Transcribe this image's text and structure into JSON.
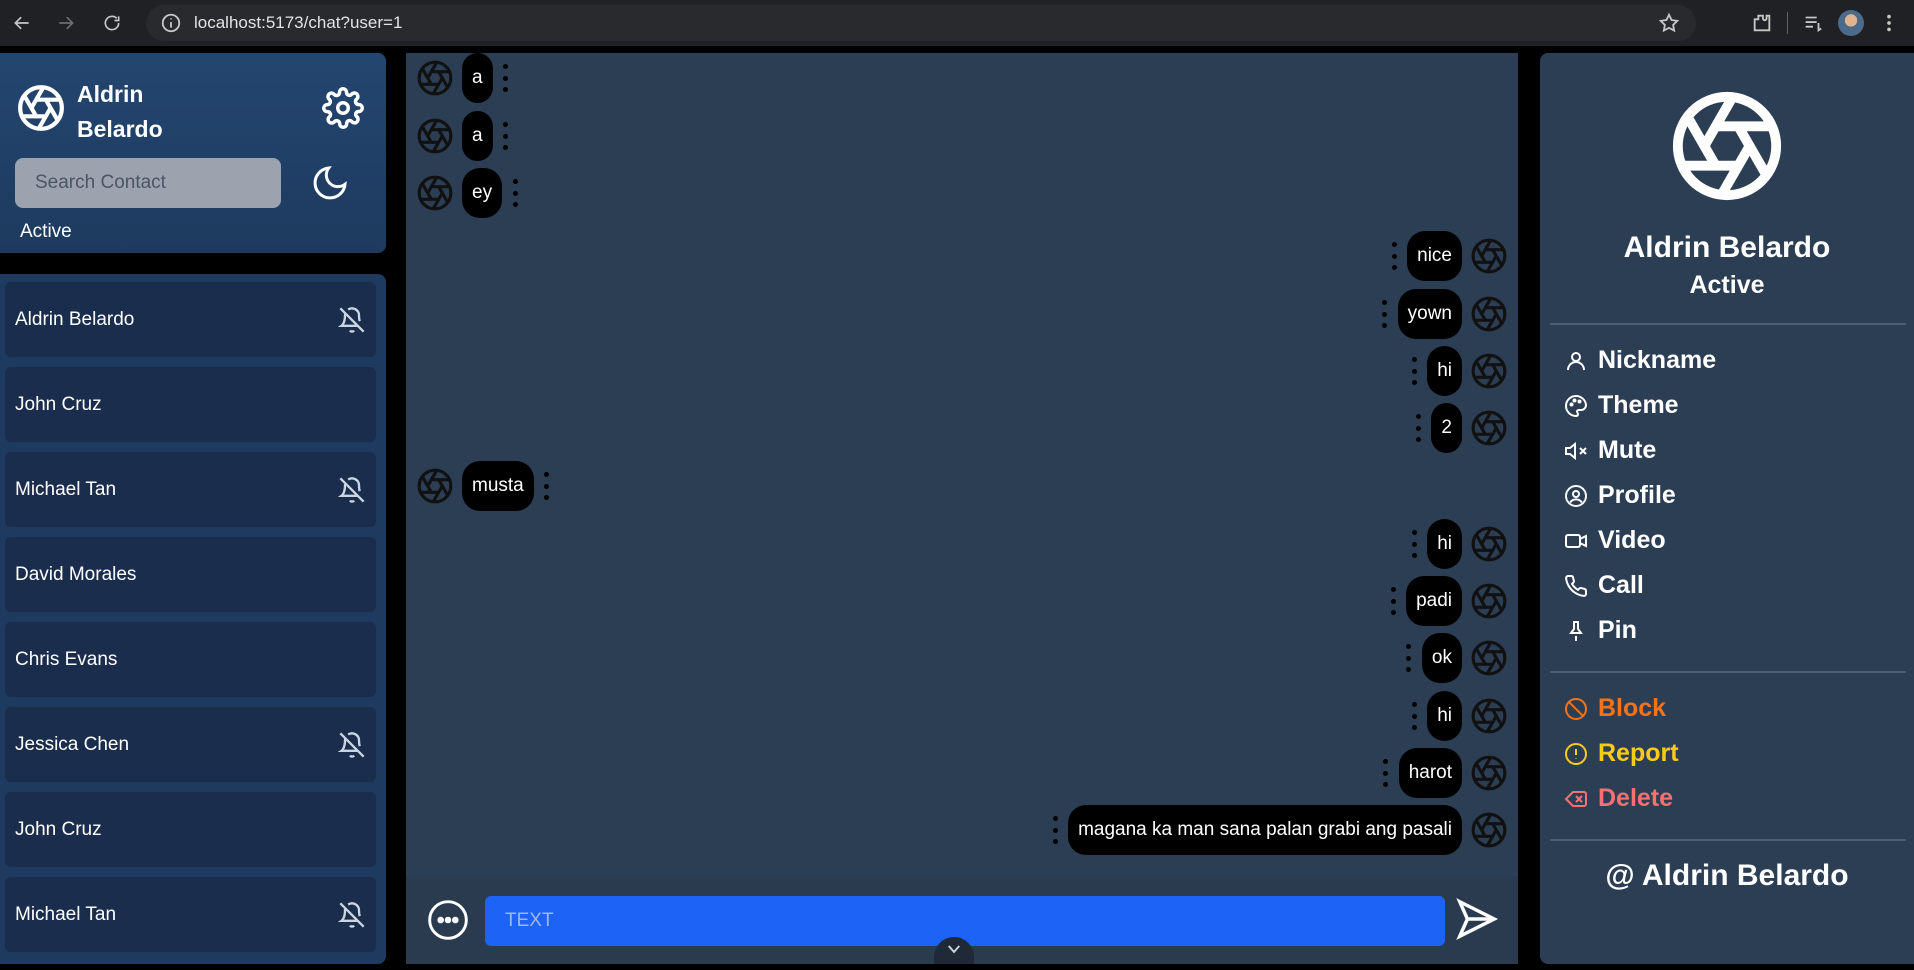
{
  "browser": {
    "url": "localhost:5173/chat?user=1"
  },
  "sidebar": {
    "user_name": "Aldrin Belardo",
    "search_placeholder": "Search Contact",
    "status_label": "Active",
    "contacts": [
      {
        "name": "Aldrin Belardo",
        "muted": true
      },
      {
        "name": "John Cruz",
        "muted": false
      },
      {
        "name": "Michael Tan",
        "muted": true
      },
      {
        "name": "David Morales",
        "muted": false
      },
      {
        "name": "Chris Evans",
        "muted": false
      },
      {
        "name": "Jessica Chen",
        "muted": true
      },
      {
        "name": "John Cruz",
        "muted": false
      },
      {
        "name": "Michael Tan",
        "muted": true
      }
    ]
  },
  "chat": {
    "messages": [
      {
        "text": "a",
        "side": "left"
      },
      {
        "text": "a",
        "side": "left"
      },
      {
        "text": "ey",
        "side": "left"
      },
      {
        "text": "nice",
        "side": "right"
      },
      {
        "text": "yown",
        "side": "right"
      },
      {
        "text": "hi",
        "side": "right"
      },
      {
        "text": "2",
        "side": "right"
      },
      {
        "text": "musta",
        "side": "left"
      },
      {
        "text": "hi",
        "side": "right"
      },
      {
        "text": "padi",
        "side": "right"
      },
      {
        "text": "ok",
        "side": "right"
      },
      {
        "text": "hi",
        "side": "right"
      },
      {
        "text": "harot",
        "side": "right"
      },
      {
        "text": "magana ka man sana palan grabi ang pasali",
        "side": "right"
      }
    ],
    "input_placeholder": "TEXT"
  },
  "details": {
    "name": "Aldrin Belardo",
    "status": "Active",
    "menu": [
      {
        "label": "Nickname",
        "icon": "user-icon",
        "color": "#ffffff"
      },
      {
        "label": "Theme",
        "icon": "palette-icon",
        "color": "#ffffff"
      },
      {
        "label": "Mute",
        "icon": "volume-x-icon",
        "color": "#ffffff"
      },
      {
        "label": "Profile",
        "icon": "user-circle-icon",
        "color": "#ffffff"
      },
      {
        "label": "Video",
        "icon": "video-icon",
        "color": "#ffffff"
      },
      {
        "label": "Call",
        "icon": "phone-icon",
        "color": "#ffffff"
      },
      {
        "label": "Pin",
        "icon": "pin-icon",
        "color": "#ffffff"
      }
    ],
    "danger_menu": [
      {
        "label": "Block",
        "icon": "ban-icon",
        "color": "#f97316"
      },
      {
        "label": "Report",
        "icon": "alert-circle-icon",
        "color": "#facc15"
      },
      {
        "label": "Delete",
        "icon": "delete-icon",
        "color": "#f87171"
      }
    ],
    "at_symbol": "@",
    "username": "Aldrin Belardo"
  }
}
